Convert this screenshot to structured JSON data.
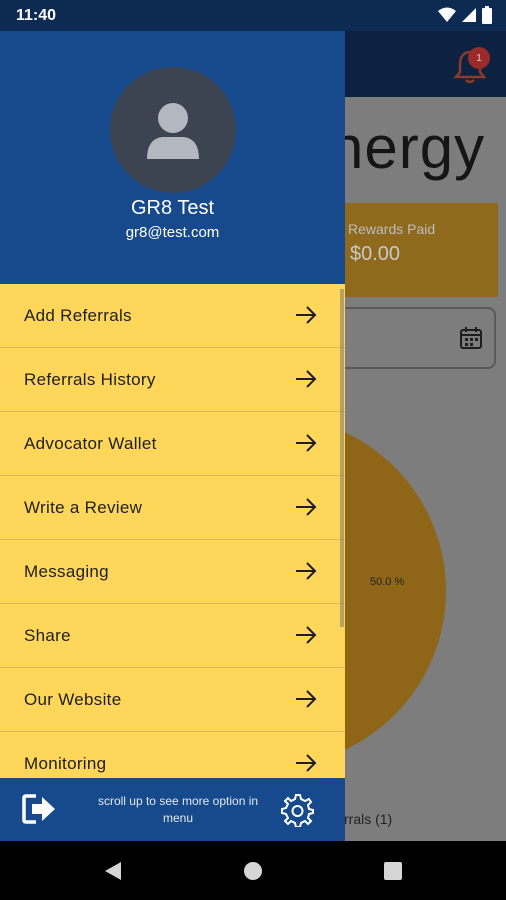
{
  "status_bar": {
    "time": "11:40"
  },
  "background_app": {
    "notification_count": "1",
    "title_fragment": "nergy",
    "rewards_label": "Rewards Paid",
    "rewards_value": "$0.00",
    "pie_percent": "50.0 %",
    "legend_fragment": "rrals (1)"
  },
  "drawer": {
    "user_name": "GR8 Test",
    "user_email": "gr8@test.com",
    "menu_items": [
      {
        "label": "Add Referrals",
        "icon": "arrow-right-icon"
      },
      {
        "label": "Referrals History",
        "icon": "arrow-right-icon"
      },
      {
        "label": "Advocator Wallet",
        "icon": "arrow-right-icon"
      },
      {
        "label": "Write a Review",
        "icon": "arrow-right-icon"
      },
      {
        "label": "Messaging",
        "icon": "arrow-right-icon"
      },
      {
        "label": "Share",
        "icon": "arrow-right-icon"
      },
      {
        "label": "Our Website",
        "icon": "arrow-right-icon"
      },
      {
        "label": "Monitoring",
        "icon": "arrow-right-icon"
      }
    ],
    "footer": {
      "hint": "scroll up to see more option in menu"
    }
  },
  "colors": {
    "drawer_header": "#174a8c",
    "menu_background": "#fdd65a",
    "status_bar": "#0d2a52"
  }
}
